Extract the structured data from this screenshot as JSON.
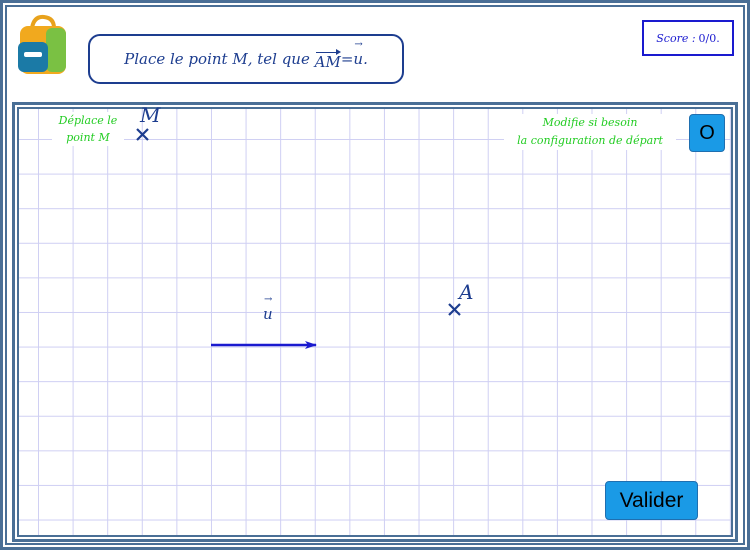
{
  "header": {
    "instruction": {
      "prefix": "Place le point ",
      "point": "M",
      "middle": ", tel que ",
      "vector": "AM",
      "equals": " = ",
      "u": "u",
      "suffix": "."
    },
    "score": {
      "label": "Score :",
      "value": "0/0."
    }
  },
  "board": {
    "hint_left": {
      "line1": "Déplace le",
      "line2": "point M"
    },
    "hint_right": {
      "line1": "Modifie si besoin",
      "line2": "la configuration de départ"
    },
    "reset_button": "O",
    "validate_button": "Valider",
    "points": {
      "M": "M",
      "A": "A"
    },
    "vector_label": "u"
  },
  "colors": {
    "frame": "#4a6f96",
    "grid": "#cfcff3",
    "ink": "#1d3d8f",
    "vector": "#1a1acf",
    "hint": "#22cc22",
    "button": "#1a9ae6"
  },
  "icons": {
    "logo": "backpack-icon",
    "point_marker": "cross-icon"
  }
}
